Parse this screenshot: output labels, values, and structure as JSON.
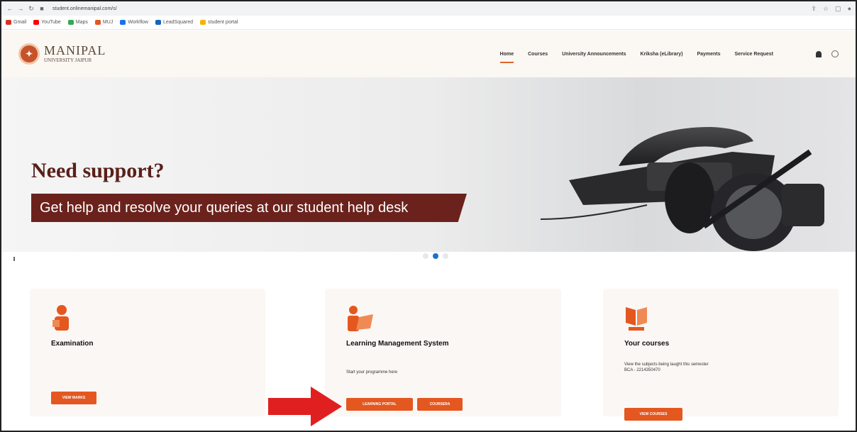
{
  "browser": {
    "url": "student.onlinemanipal.com/s/",
    "bookmarks": [
      "Gmail",
      "YouTube",
      "Maps",
      "MUJ",
      "Workflow",
      "LeadSquared",
      "student portal"
    ]
  },
  "header": {
    "logo_line1": "MANIPAL",
    "logo_line2": "UNIVERSITY JAIPUR",
    "nav": [
      "Home",
      "Courses",
      "University Announcements",
      "Kriksha (eLibrary)",
      "Payments",
      "Service Request"
    ]
  },
  "hero": {
    "title": "Need support?",
    "subtitle": "Get help and resolve your queries at our student help desk"
  },
  "cards": [
    {
      "title": "Examination",
      "desc": "",
      "buttons": [
        "View Marks"
      ]
    },
    {
      "title": "Learning Management System",
      "desc": "Start your programme here",
      "buttons": [
        "LEARNING PORTAL",
        "COURSERA"
      ]
    },
    {
      "title": "Your courses",
      "desc": "View the subjects being taught this semester",
      "desc2": "BCA - 2214350470",
      "buttons": [
        "VIEW COURSES"
      ]
    }
  ],
  "colors": {
    "accent": "#e4571f",
    "hero_banner": "#6b221c",
    "active_dot": "#1a73c8",
    "arrow": "#e02020"
  }
}
